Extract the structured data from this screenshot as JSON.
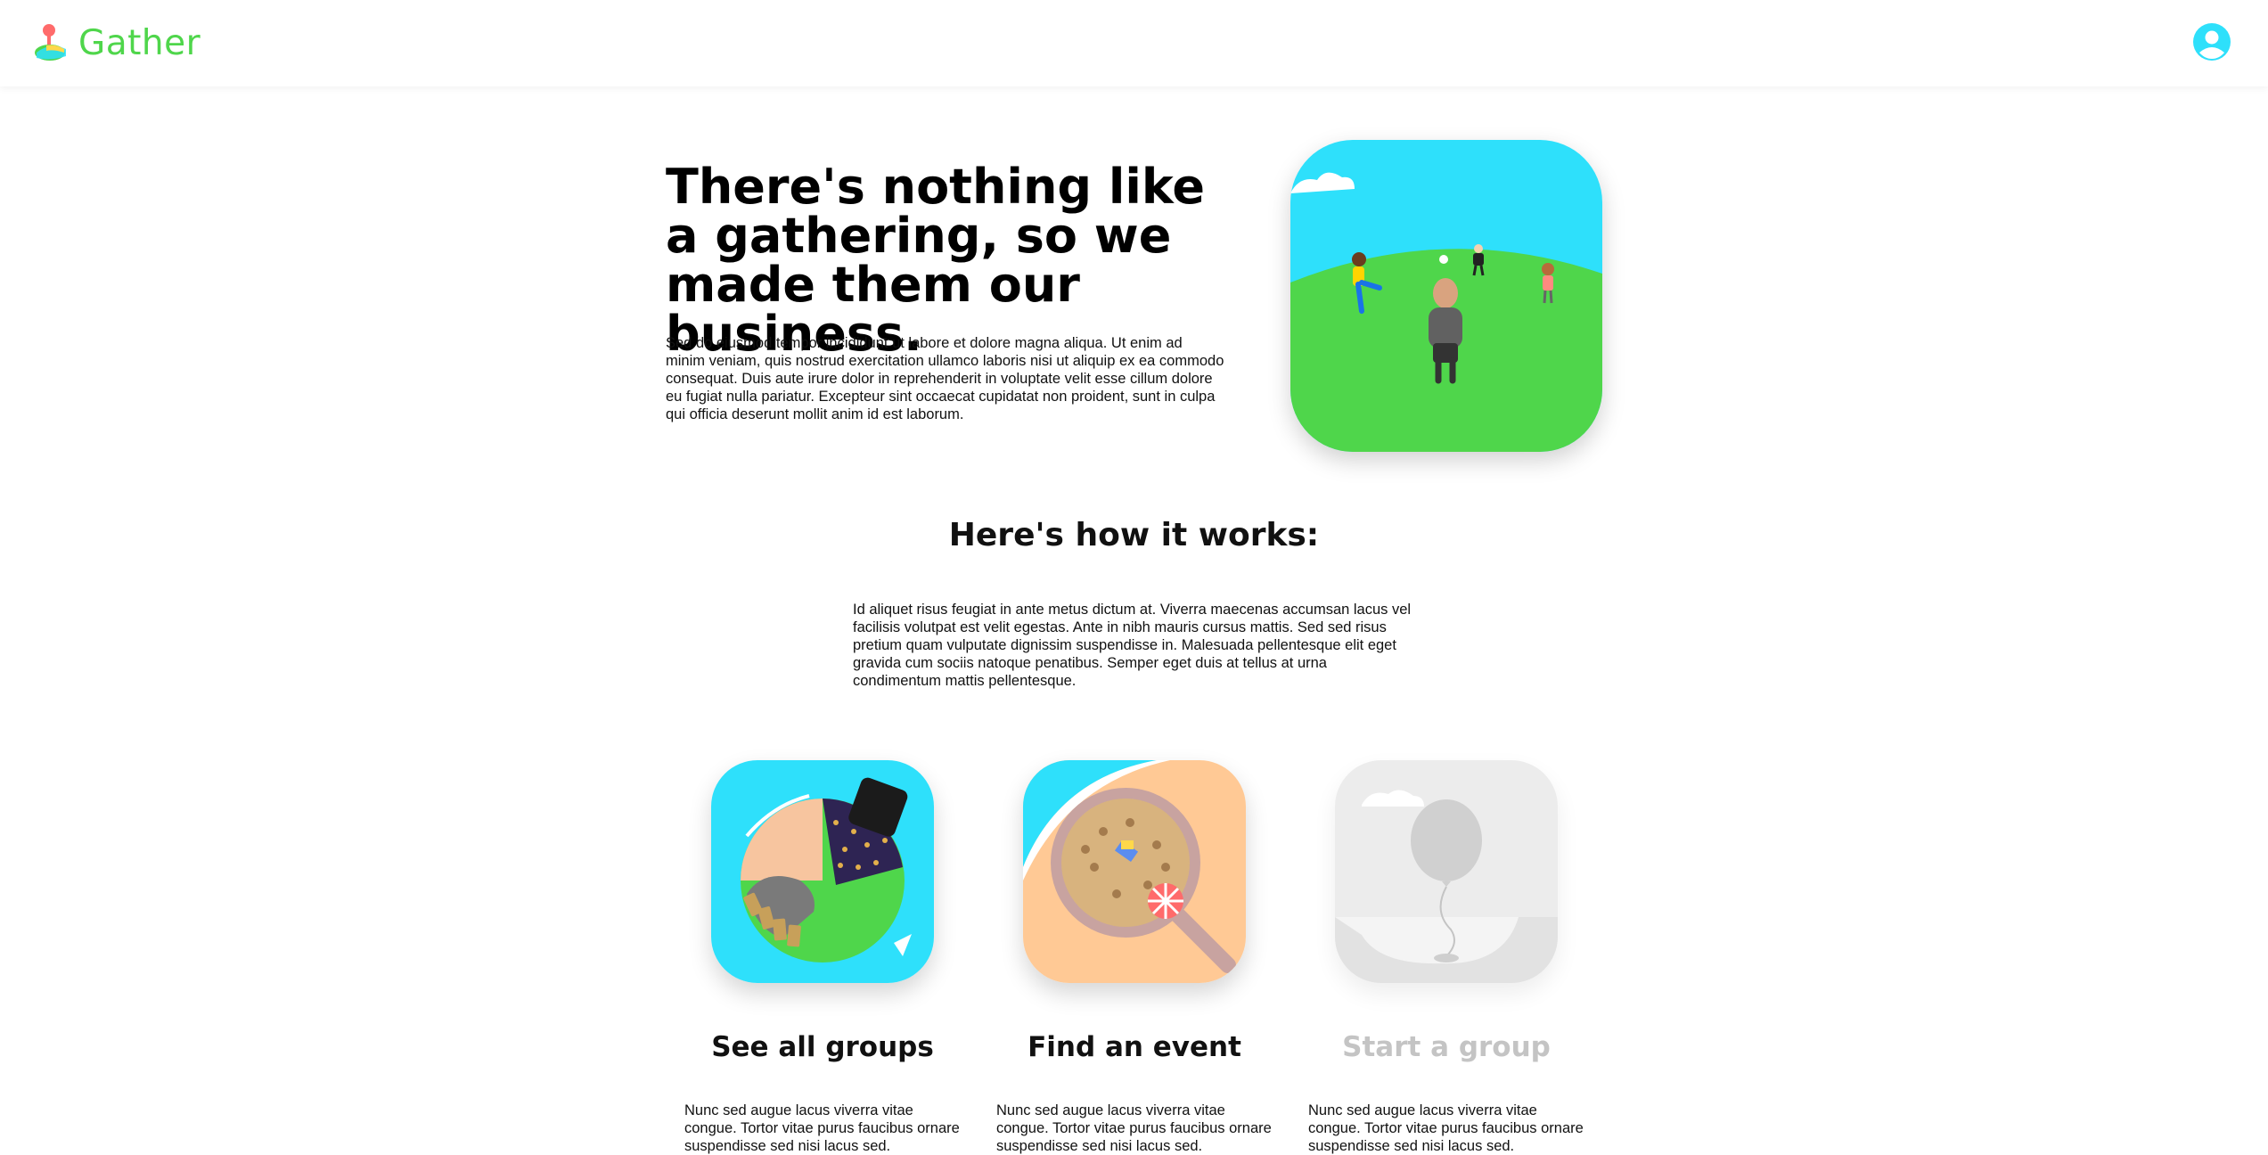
{
  "header": {
    "logo_text": "Gather",
    "logo_icon": "person-pin-icon",
    "profile_icon": "user-avatar-icon",
    "brand_color": "#4fd64b",
    "accent_color": "#2ee0fb"
  },
  "hero": {
    "title": "There's nothing like a gathering, so we made them our business.",
    "body": "Sed do eiusmod tempor incididunt ut labore et dolore magna aliqua. Ut enim ad minim veniam, quis nostrud exercitation ullamco laboris nisi ut aliquip ex ea commodo consequat. Duis aute irure dolor in reprehenderit in voluptate velit esse cillum dolore eu fugiat nulla pariatur. Excepteur sint occaecat cupidatat non proident, sunt in culpa qui officia deserunt mollit anim id est laborum.",
    "image": "people-playing-in-park-illustration"
  },
  "how": {
    "title": "Here's how it works:",
    "body": "Id aliquet risus feugiat in ante metus dictum at. Viverra maecenas accumsan lacus vel facilisis volutpat est velit egestas. Ante in nibh mauris cursus mattis. Sed sed risus pretium quam vulputate dignissim suspendisse in. Malesuada pellentesque elit eget gravida cum sociis natoque penatibus. Semper eget duis at tellus at urna condimentum mattis pellentesque."
  },
  "cards": [
    {
      "title": "See all groups",
      "body": "Nunc sed augue lacus viverra vitae congue. Tortor vitae purus faucibus ornare suspendisse sed nisi lacus sed.",
      "image": "tiny-planet-city-illustration",
      "enabled": true
    },
    {
      "title": "Find an event",
      "body": "Nunc sed augue lacus viverra vitae congue. Tortor vitae purus faucibus ornare suspendisse sed nisi lacus sed.",
      "image": "magnifying-glass-beach-illustration",
      "enabled": true
    },
    {
      "title": "Start a group",
      "body": "Nunc sed augue lacus viverra vitae congue. Tortor vitae purus faucibus ornare suspendisse sed nisi lacus sed.",
      "image": "balloon-illustration",
      "enabled": false
    }
  ]
}
